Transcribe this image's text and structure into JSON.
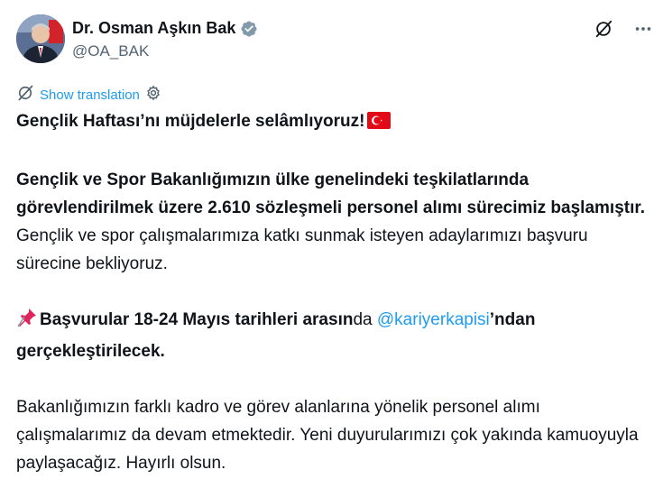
{
  "author": {
    "name": "Dr. Osman Aşkın Bak",
    "handle": "@OA_BAK"
  },
  "translate_label": "Show translation",
  "icons": {
    "verified": "verified-badge-icon",
    "grok": "grok-icon",
    "more": "more-icon",
    "translate": "translate-icon",
    "settings": "gear-icon",
    "flag": "turkey-flag-emoji",
    "pin": "pushpin-emoji"
  },
  "colors": {
    "link": "#1d9bf0",
    "text": "#0f1419",
    "secondary": "#536471"
  },
  "tweet": {
    "p1": "Gençlik Haftası’nı müjdelerle selâmlıyoruz!",
    "p2_bold": "Gençlik ve Spor Bakanlığımızın ülke genelindeki teşkilatlarında görevlendirilmek üzere 2.610 sözleşmeli personel alımı sürecimiz başlamıştır.",
    "p2_rest": " Gençlik ve spor çalışmalarımıza katkı sunmak isteyen adaylarımızı başvuru sürecine bekliyoruz.",
    "p3_bold": "Başvurular 18-24 Mayıs tarihleri arasın",
    "p3_mid": "da ",
    "p3_mention": "@kariyerkapisi",
    "p3_end": "’ndan gerçekleştirilecek.",
    "p4": "Bakanlığımızın farklı kadro ve görev alanlarına yönelik personel alımı çalışmalarımız da devam etmektedir. Yeni duyurularımızı çok yakında kamuoyuyla paylaşacağız. Hayırlı olsun."
  }
}
